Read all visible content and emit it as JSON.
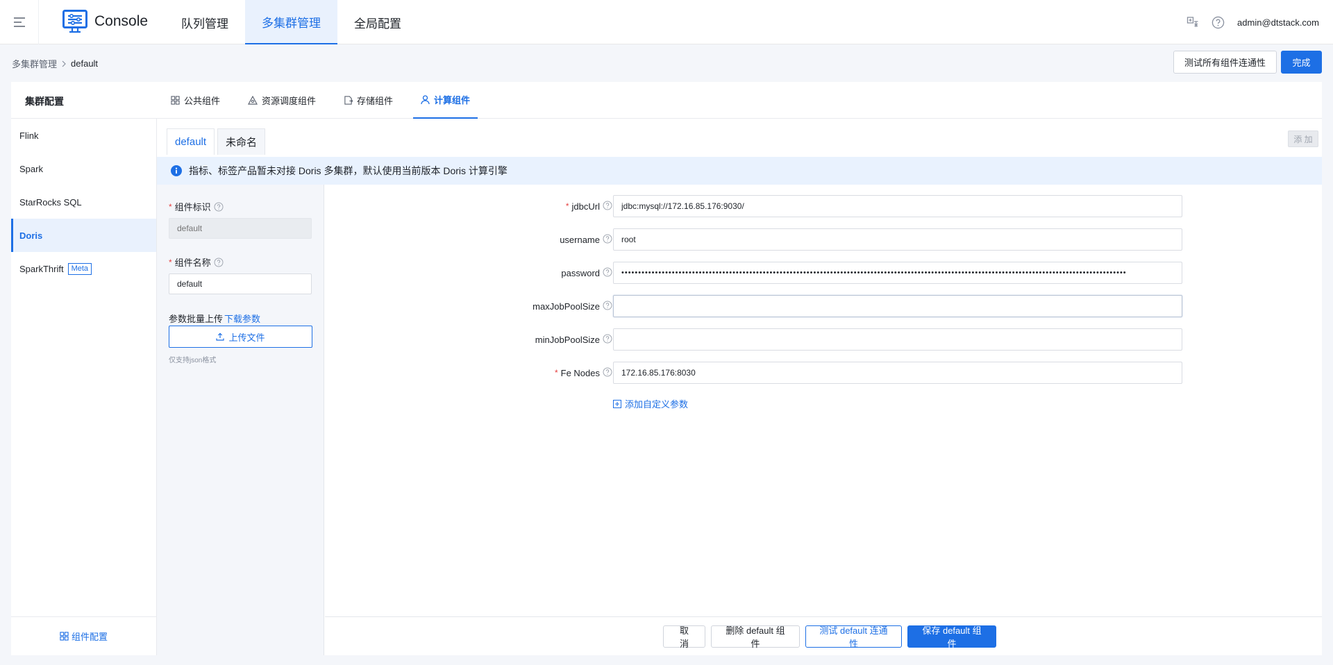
{
  "header": {
    "logo_text": "Console",
    "nav": [
      {
        "label": "队列管理"
      },
      {
        "label": "多集群管理"
      },
      {
        "label": "全局配置"
      }
    ],
    "user": "admin@dtstack.com"
  },
  "breadcrumb": {
    "parent": "多集群管理",
    "current": "default"
  },
  "actions": {
    "test_all": "测试所有组件连通性",
    "done": "完成"
  },
  "card": {
    "title": "集群配置",
    "tabs": [
      {
        "label": "公共组件",
        "icon": "grid-icon"
      },
      {
        "label": "资源调度组件",
        "icon": "triangle-icon"
      },
      {
        "label": "存储组件",
        "icon": "storage-icon"
      },
      {
        "label": "计算组件",
        "icon": "user-icon"
      }
    ]
  },
  "components": {
    "items": [
      {
        "label": "Flink"
      },
      {
        "label": "Spark"
      },
      {
        "label": "StarRocks SQL"
      },
      {
        "label": "Doris"
      },
      {
        "label": "SparkThrift",
        "tag": "Meta"
      }
    ],
    "footer": "组件配置"
  },
  "subtabs": [
    {
      "label": "default"
    },
    {
      "label": "未命名"
    }
  ],
  "add_label": "添 加",
  "alert": "指标、标签产品暂未对接 Doris 多集群，默认使用当前版本 Doris 计算引擎",
  "side_form": {
    "id_label": "组件标识",
    "id_value": "default",
    "name_label": "组件名称",
    "name_value": "default",
    "batch_label": "参数批量上传",
    "download": "下载参数",
    "upload": "上传文件",
    "hint": "仅支持json格式"
  },
  "fields": [
    {
      "label": "jdbcUrl",
      "required": true,
      "value": "jdbc:mysql://172.16.85.176:9030/"
    },
    {
      "label": "username",
      "required": false,
      "value": "root"
    },
    {
      "label": "password",
      "required": false,
      "value": "••••••••••••••••••••••••••••••••••••••••••••••••••••••••••••••••••••••••••••••••••••••••••••••••••••••••••••••••••••••••••••••••••••••••••••••••••••••"
    },
    {
      "label": "maxJobPoolSize",
      "required": false,
      "value": ""
    },
    {
      "label": "minJobPoolSize",
      "required": false,
      "value": ""
    },
    {
      "label": "Fe Nodes",
      "required": true,
      "value": "172.16.85.176:8030"
    }
  ],
  "add_custom": "添加自定义参数",
  "footer_buttons": {
    "cancel": "取 消",
    "delete": "删除 default 组件",
    "test": "测试 default 连通性",
    "save": "保存 default 组件"
  }
}
